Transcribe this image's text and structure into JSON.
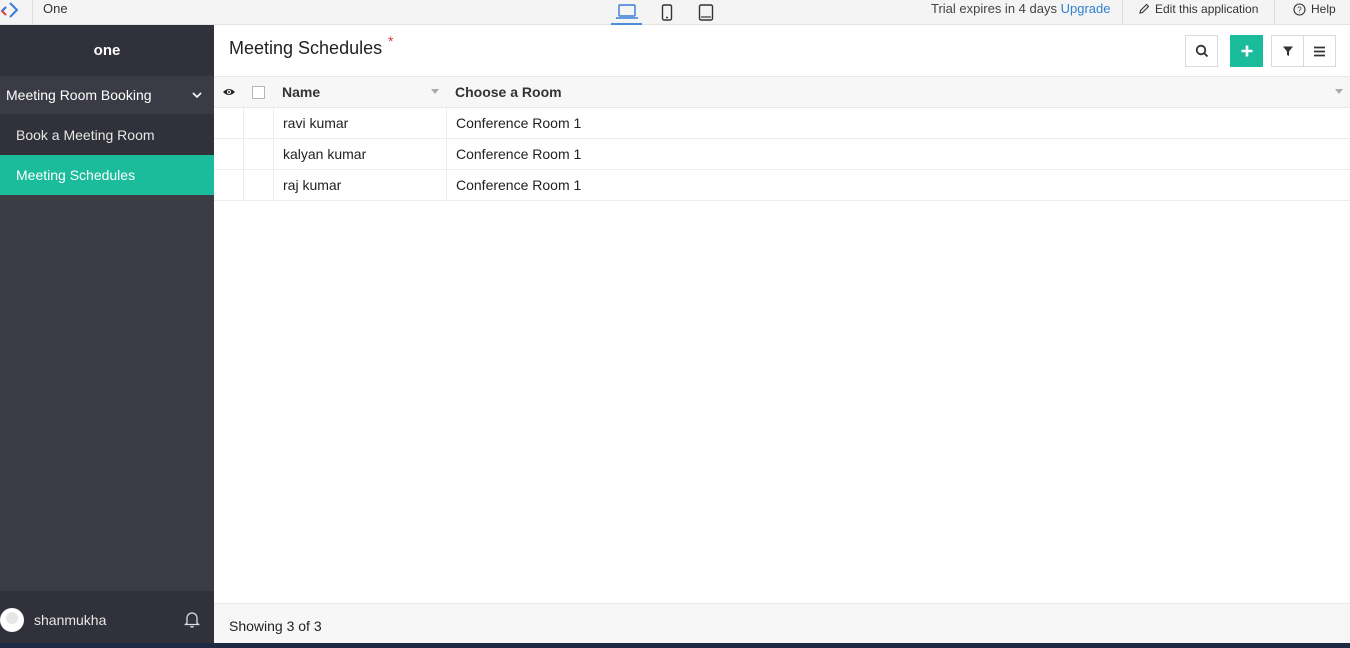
{
  "topbar": {
    "app_name": "One",
    "trial_text": "Trial expires in 4 days",
    "upgrade_label": "Upgrade",
    "edit_label": "Edit this application",
    "help_label": "Help",
    "devices": [
      "laptop-icon",
      "phone-icon",
      "tablet-icon"
    ],
    "active_device": "laptop"
  },
  "sidebar": {
    "title": "one",
    "group_label": "Meeting Room Booking",
    "items": [
      {
        "label": "Book a Meeting Room",
        "active": false
      },
      {
        "label": "Meeting Schedules",
        "active": true
      }
    ],
    "user_name": "shanmukha"
  },
  "main": {
    "title": "Meeting Schedules",
    "required_marker": "*",
    "toolbar": {
      "search_icon": "search-icon",
      "add_icon": "plus-icon",
      "filter_icon": "filter-icon",
      "menu_icon": "menu-icon"
    },
    "table": {
      "columns": [
        "Name",
        "Choose a Room"
      ],
      "rows": [
        {
          "name": "ravi kumar",
          "room": "Conference Room 1"
        },
        {
          "name": "kalyan kumar",
          "room": "Conference Room 1"
        },
        {
          "name": "raj kumar",
          "room": "Conference Room 1"
        }
      ]
    },
    "footer_text": "Showing 3 of 3"
  },
  "colors": {
    "accent": "#1abc9c",
    "sidebar_bg": "#3a3b45",
    "sidebar_dark": "#30313a",
    "link": "#2f80d1",
    "required": "#e53935"
  }
}
